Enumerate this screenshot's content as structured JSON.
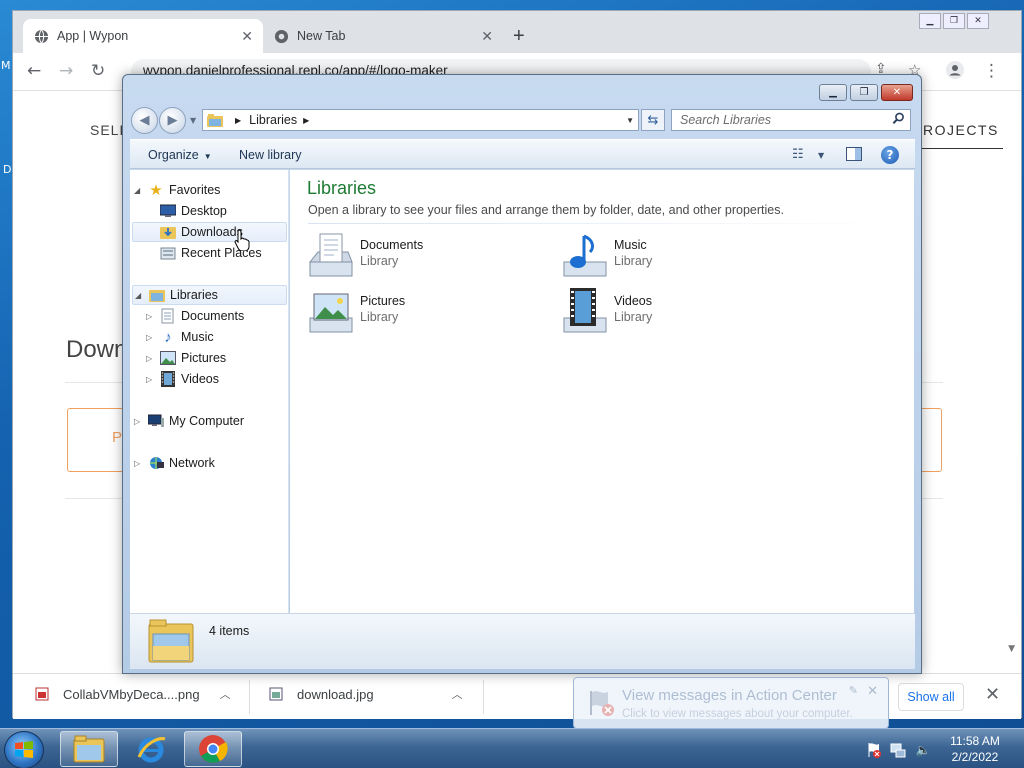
{
  "desktop": {
    "left_letters": [
      "M",
      "D"
    ]
  },
  "chrome": {
    "tabs": [
      {
        "title": "App | Wypon",
        "active": true
      },
      {
        "title": "New Tab",
        "active": false
      }
    ],
    "new_tab_label": "+",
    "url": "wypon.danielprofessional.repl.co/app/#/logo-maker",
    "page": {
      "nav_left_text": "SELE",
      "nav_right_text": "ROJECTS",
      "heading_text": "Down",
      "box_text": "P"
    },
    "downloads": [
      {
        "filename": "CollabVMbyDeca....png"
      },
      {
        "filename": "download.jpg"
      }
    ],
    "show_all_label": "Show all"
  },
  "explorer": {
    "address": {
      "crumb": "Libraries"
    },
    "search_placeholder": "Search Libraries",
    "commands": {
      "organize": "Organize",
      "new_library": "New library"
    },
    "nav": {
      "favorites": {
        "label": "Favorites",
        "items": [
          "Desktop",
          "Downloads",
          "Recent Places"
        ]
      },
      "libraries": {
        "label": "Libraries",
        "items": [
          "Documents",
          "Music",
          "Pictures",
          "Videos"
        ]
      },
      "computer": "My Computer",
      "network": "Network"
    },
    "content": {
      "title": "Libraries",
      "subtitle": "Open a library to see your files and arrange them by folder, date, and other properties.",
      "items": [
        {
          "name": "Documents",
          "type": "Library",
          "icon": "documents-library-icon"
        },
        {
          "name": "Music",
          "type": "Library",
          "icon": "music-library-icon"
        },
        {
          "name": "Pictures",
          "type": "Library",
          "icon": "pictures-library-icon"
        },
        {
          "name": "Videos",
          "type": "Library",
          "icon": "videos-library-icon"
        }
      ]
    },
    "status": {
      "count": "4 items"
    }
  },
  "notification": {
    "title": "View messages in Action Center",
    "body": "Click to view messages about your computer."
  },
  "taskbar": {
    "time": "11:58 AM",
    "date": "2/2/2022"
  },
  "colors": {
    "library_title": "#1e7b34",
    "close_button": "#c0392b",
    "chrome_link": "#1a73e8"
  }
}
